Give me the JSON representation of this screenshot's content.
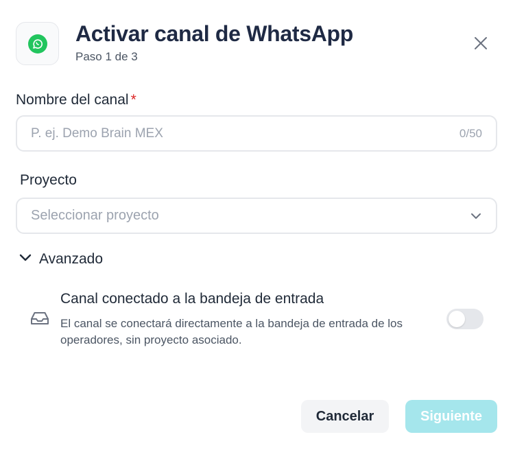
{
  "header": {
    "title": "Activar canal de WhatsApp",
    "subtitle": "Paso 1 de 3",
    "icon": "whatsapp-icon"
  },
  "channel_name": {
    "label": "Nombre del canal",
    "required_mark": "*",
    "placeholder": "P. ej. Demo Brain MEX",
    "value": "",
    "counter": "0/50"
  },
  "project": {
    "label": "Proyecto",
    "placeholder": "Seleccionar proyecto"
  },
  "advanced": {
    "label": "Avanzado",
    "option": {
      "title": "Canal conectado a la bandeja de entrada",
      "description": "El canal se conectará directamente a la bandeja de entrada de los operadores, sin proyecto asociado.",
      "enabled": false
    }
  },
  "footer": {
    "cancel_label": "Cancelar",
    "next_label": "Siguiente"
  },
  "colors": {
    "accent": "#a5e6ec",
    "whatsapp": "#22c55e",
    "required": "#dc2626"
  }
}
